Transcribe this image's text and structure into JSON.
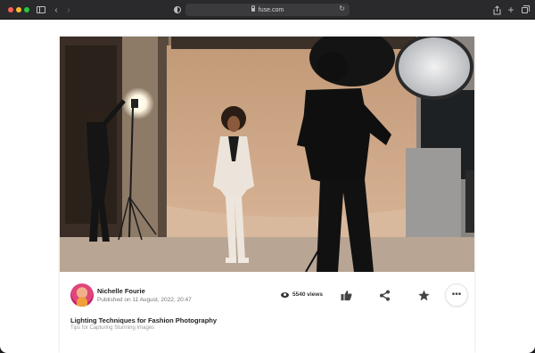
{
  "browser": {
    "url": "fuse.com",
    "icons": [
      "sidebar-icon",
      "back-icon",
      "forward-icon",
      "shield-icon",
      "lock-icon",
      "reload-icon",
      "share-icon",
      "plus-icon",
      "tabs-icon"
    ]
  },
  "photo": {
    "description_icon": "image"
  },
  "post": {
    "author": "Nichelle Fourie",
    "published": "Published on 11 August, 2022, 20:47",
    "views": "5540 views",
    "title": "Lighting Techniques for Fashion Photography",
    "subtitle": "Tips for Capturing Stunning Images",
    "actions": [
      "like",
      "share",
      "favorite",
      "more"
    ]
  },
  "colors": {
    "close": "#ff5f57",
    "minimize": "#febc2e",
    "maximize": "#28c840"
  }
}
